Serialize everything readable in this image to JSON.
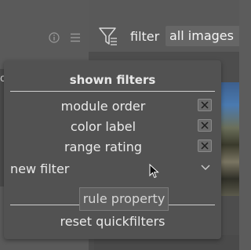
{
  "toolbar": {
    "filter_label": "filter",
    "filter_dropdown_value": "all images",
    "icons": [
      "info-icon",
      "menu-icon",
      "filter-icon"
    ]
  },
  "background_edge": {
    "partial_text": "o"
  },
  "popup": {
    "title": "shown filters",
    "filters": [
      {
        "label": "module order"
      },
      {
        "label": "color label"
      },
      {
        "label": "range rating"
      }
    ],
    "new_filter_label": "new filter",
    "rule_property_label": "rule property",
    "reset_label": "reset quickfilters"
  },
  "colors": {
    "popup_bg": "#525252",
    "separator": "#d0d0d0",
    "text": "#eaeaea"
  }
}
